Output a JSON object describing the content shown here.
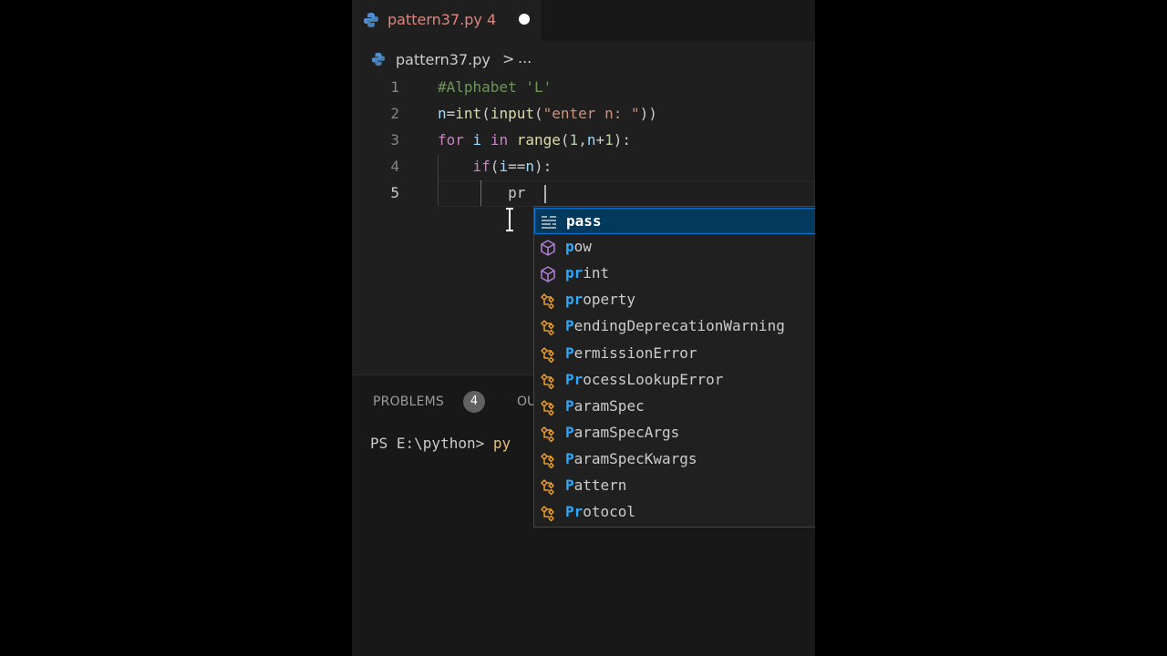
{
  "tab": {
    "title": "pattern37.py 4"
  },
  "breadcrumb": {
    "file": "pattern37.py",
    "separator": ">",
    "more": "..."
  },
  "editor": {
    "lines": [
      {
        "num": "1",
        "tokens": [
          {
            "t": "#Alphabet 'L'",
            "c": "cm"
          }
        ]
      },
      {
        "num": "2",
        "tokens": [
          {
            "t": "n",
            "c": "var"
          },
          {
            "t": "=",
            "c": ""
          },
          {
            "t": "int",
            "c": "fn"
          },
          {
            "t": "(",
            "c": ""
          },
          {
            "t": "input",
            "c": "fn"
          },
          {
            "t": "(",
            "c": ""
          },
          {
            "t": "\"enter n: \"",
            "c": "str"
          },
          {
            "t": "))",
            "c": ""
          }
        ]
      },
      {
        "num": "3",
        "tokens": [
          {
            "t": "for",
            "c": "kw"
          },
          {
            "t": " ",
            "c": ""
          },
          {
            "t": "i",
            "c": "var"
          },
          {
            "t": " ",
            "c": ""
          },
          {
            "t": "in",
            "c": "kw"
          },
          {
            "t": " ",
            "c": ""
          },
          {
            "t": "range",
            "c": "fn"
          },
          {
            "t": "(",
            "c": ""
          },
          {
            "t": "1",
            "c": "num"
          },
          {
            "t": ",",
            "c": ""
          },
          {
            "t": "n",
            "c": "var"
          },
          {
            "t": "+",
            "c": ""
          },
          {
            "t": "1",
            "c": "num"
          },
          {
            "t": "):",
            "c": ""
          }
        ]
      },
      {
        "num": "4",
        "tokens": [
          {
            "t": "    ",
            "c": ""
          },
          {
            "t": "if",
            "c": "kw"
          },
          {
            "t": "(",
            "c": ""
          },
          {
            "t": "i",
            "c": "var"
          },
          {
            "t": "==",
            "c": ""
          },
          {
            "t": "n",
            "c": "var"
          },
          {
            "t": "):",
            "c": ""
          }
        ]
      },
      {
        "num": "5",
        "tokens": [
          {
            "t": "        ",
            "c": ""
          },
          {
            "t": "pr",
            "c": ""
          }
        ]
      }
    ]
  },
  "panel": {
    "problems_label": "PROBLEMS",
    "problems_count": "4",
    "output_label": "OU",
    "terminal_prompt": "PS E:\\python> ",
    "terminal_cmd": "py"
  },
  "suggestions": [
    {
      "match": "pass",
      "rest": "",
      "kind": "keyword-icon"
    },
    {
      "match": "p",
      "rest": "ow",
      "kind": "method-icon"
    },
    {
      "match": "pr",
      "rest": "int",
      "kind": "method-icon"
    },
    {
      "match": "pr",
      "rest": "operty",
      "kind": "class-icon"
    },
    {
      "match": "P",
      "rest": "endingDeprecationWarning",
      "kind": "class-icon"
    },
    {
      "match": "P",
      "rest": "ermissionError",
      "kind": "class-icon"
    },
    {
      "match": "Pr",
      "rest": "ocessLookupError",
      "kind": "class-icon"
    },
    {
      "match": "P",
      "rest": "aramSpec",
      "kind": "class-icon"
    },
    {
      "match": "P",
      "rest": "aramSpecArgs",
      "kind": "class-icon"
    },
    {
      "match": "P",
      "rest": "aramSpecKwargs",
      "kind": "class-icon"
    },
    {
      "match": "P",
      "rest": "attern",
      "kind": "class-icon"
    },
    {
      "match": "Pr",
      "rest": "otocol",
      "kind": "class-icon"
    }
  ],
  "colors": {
    "selection_bg": "#04395e",
    "selection_border": "#0078d4",
    "match": "#2aaaff",
    "modified_tab": "#e2857e"
  }
}
